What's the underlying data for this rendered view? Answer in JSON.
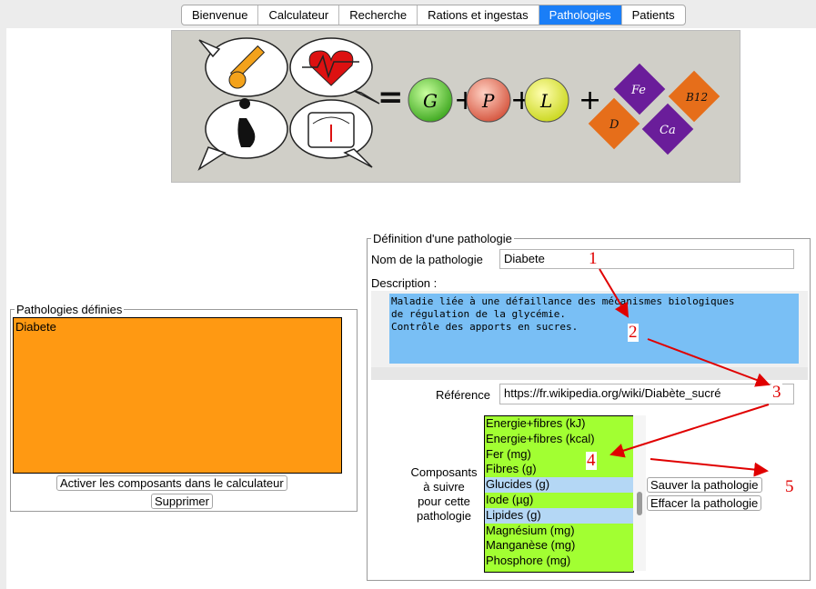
{
  "tabs": [
    {
      "label": "Bienvenue",
      "active": false
    },
    {
      "label": "Calculateur",
      "active": false
    },
    {
      "label": "Recherche",
      "active": false
    },
    {
      "label": "Rations et ingestas",
      "active": false
    },
    {
      "label": "Pathologies",
      "active": true
    },
    {
      "label": "Patients",
      "active": false
    }
  ],
  "banner": {
    "equals": "=",
    "plus": "+",
    "circles": [
      "G",
      "P",
      "L"
    ],
    "diamonds": [
      "Fe",
      "B12",
      "D",
      "Ca"
    ]
  },
  "defined": {
    "legend": "Pathologies définies",
    "items": [
      "Diabete"
    ],
    "activate_label": "Activer les composants dans le calculateur",
    "delete_label": "Supprimer"
  },
  "definition": {
    "legend": "Définition d'une pathologie",
    "name_label": "Nom de la pathologie",
    "name_value": "Diabete",
    "desc_label": "Description :",
    "desc_value": "Maladie liée à une défaillance des mécanismes biologiques\nde régulation de la glycémie.\nContrôle des apports en sucres.",
    "ref_label": "Référence",
    "ref_value": "https://fr.wikipedia.org/wiki/Diabète_sucré",
    "comp_label": "Composants\nà suivre\npour cette\npathologie",
    "components": [
      {
        "label": "Energie+fibres (kJ)",
        "selected": false
      },
      {
        "label": "Energie+fibres (kcal)",
        "selected": false
      },
      {
        "label": "Fer (mg)",
        "selected": false
      },
      {
        "label": "Fibres (g)",
        "selected": false
      },
      {
        "label": "Glucides (g)",
        "selected": true
      },
      {
        "label": "Iode (µg)",
        "selected": false
      },
      {
        "label": "Lipides (g)",
        "selected": true
      },
      {
        "label": "Magnésium (mg)",
        "selected": false
      },
      {
        "label": "Manganèse (mg)",
        "selected": false
      },
      {
        "label": "Phosphore (mg)",
        "selected": false
      }
    ],
    "save_label": "Sauver la pathologie",
    "clear_label": "Effacer la pathologie"
  },
  "annotations": [
    "1",
    "2",
    "3",
    "4",
    "5"
  ],
  "colors": {
    "orange_list": "#ff9912",
    "desc_bg": "#79bff5",
    "comp_bg": "#a2ff32",
    "selected": "#b4d7f5",
    "tab_active": "#1a7ef7",
    "annotation": "#e00000"
  }
}
